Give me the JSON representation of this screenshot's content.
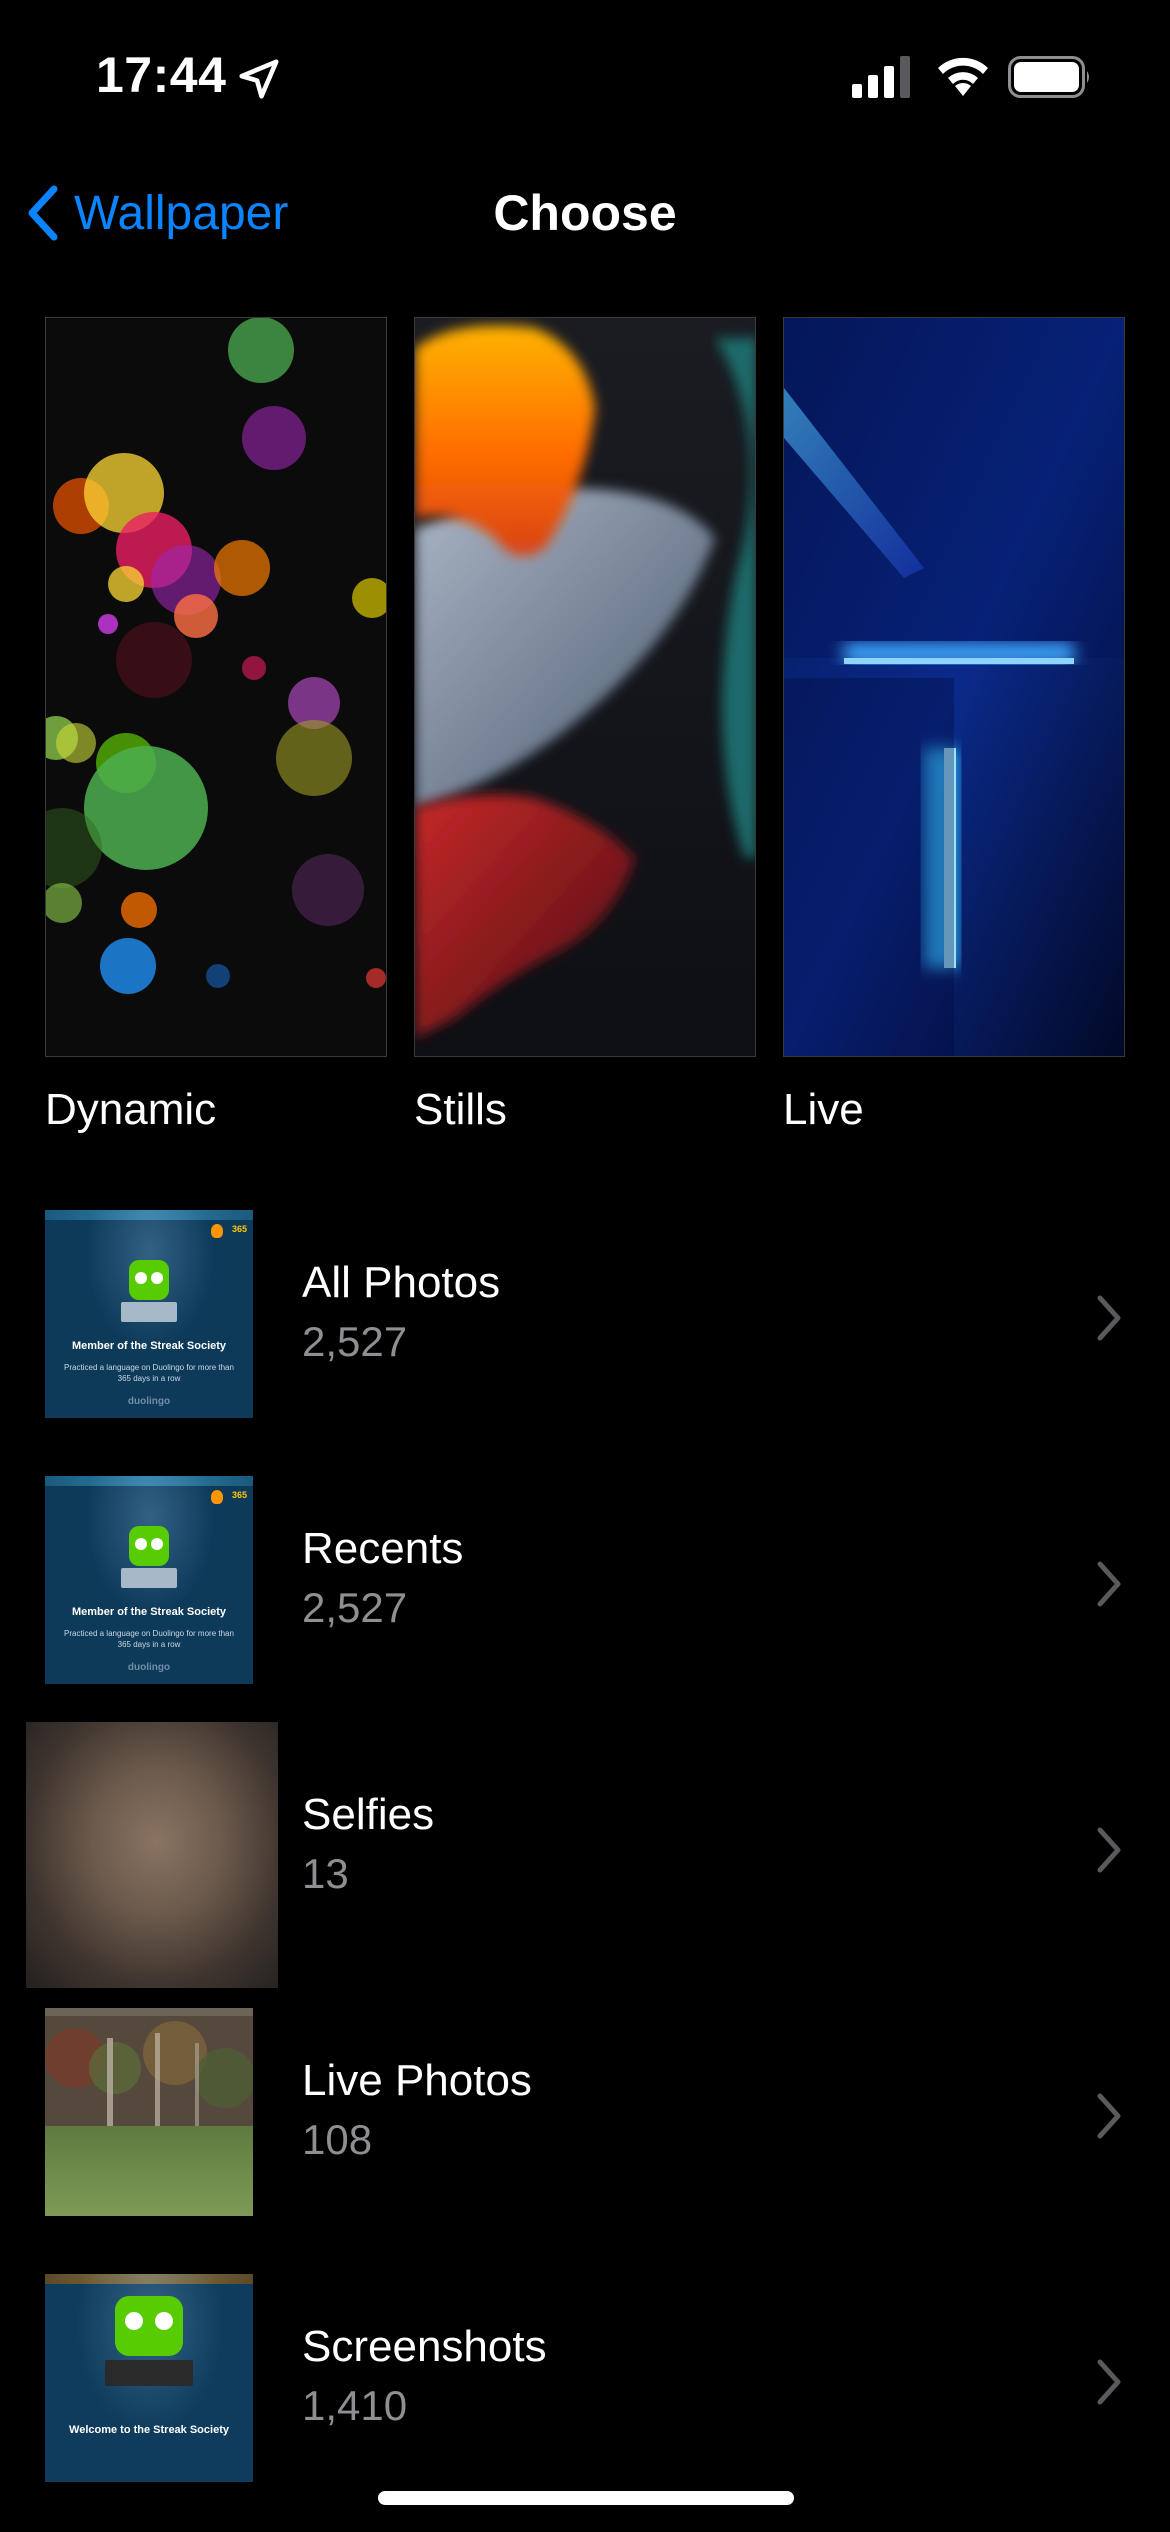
{
  "status_bar": {
    "time": "17:44",
    "location_icon": "location-arrow-icon",
    "signal_icon": "cellular-signal-icon",
    "wifi_icon": "wifi-icon",
    "battery_icon": "battery-icon"
  },
  "nav": {
    "back_label": "Wallpaper",
    "title": "Choose",
    "accent_color": "#0a84ff"
  },
  "categories": [
    {
      "label": "Dynamic"
    },
    {
      "label": "Stills"
    },
    {
      "label": "Live"
    }
  ],
  "albums": [
    {
      "name": "All Photos",
      "count": "2,527",
      "thumb": {
        "heading": "Member of the Streak Society",
        "body": "Practiced a language on Duolingo for more than 365 days in a row",
        "brand": "duolingo",
        "streak": "365"
      }
    },
    {
      "name": "Recents",
      "count": "2,527",
      "thumb": {
        "heading": "Member of the Streak Society",
        "body": "Practiced a language on Duolingo for more than 365 days in a row",
        "brand": "duolingo",
        "streak": "365"
      }
    },
    {
      "name": "Selfies",
      "count": "13"
    },
    {
      "name": "Live Photos",
      "count": "108"
    },
    {
      "name": "Screenshots",
      "count": "1,410",
      "thumb": {
        "heading": "Welcome to the Streak Society"
      }
    }
  ],
  "colors": {
    "background": "#000000",
    "secondary_text": "#8e8e93",
    "chevron": "#5a5a5e"
  }
}
